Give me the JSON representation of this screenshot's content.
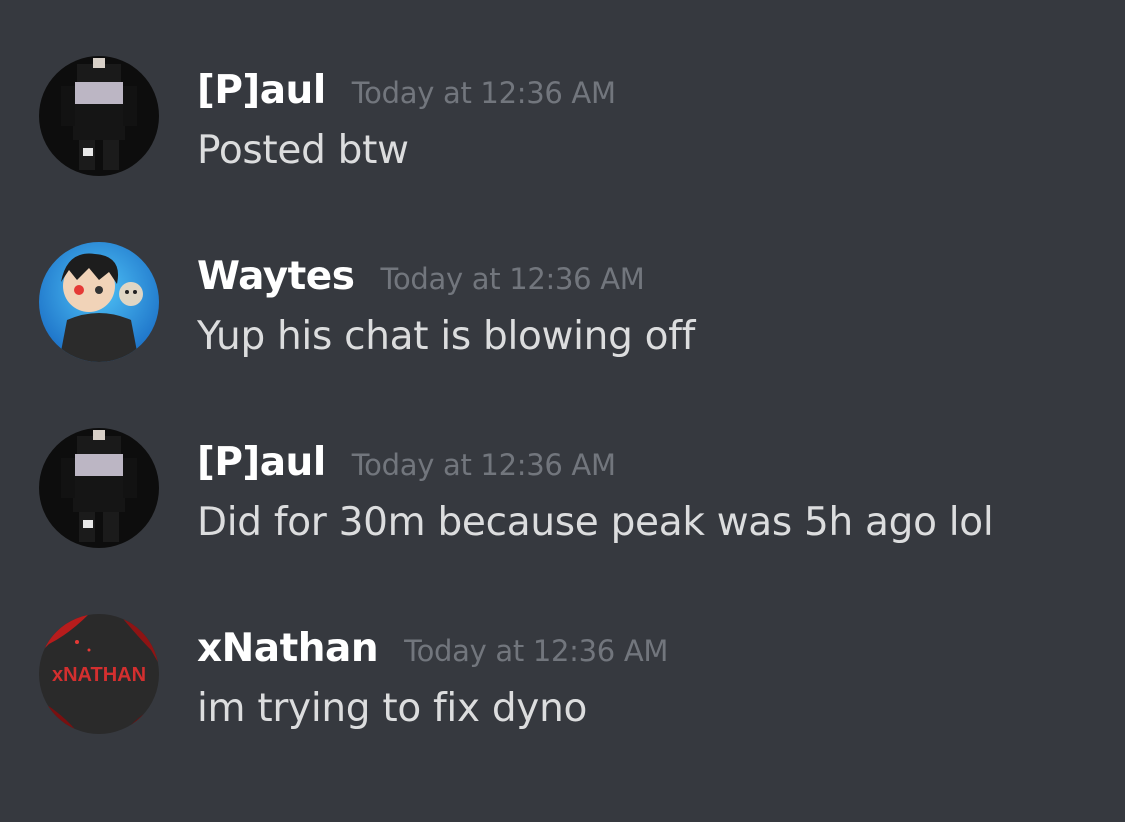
{
  "messages": [
    {
      "username": "[P]aul",
      "timestamp": "Today at 12:36 AM",
      "text": "Posted btw",
      "avatar": "paul-avatar"
    },
    {
      "username": "Waytes",
      "timestamp": "Today at 12:36 AM",
      "text": "Yup his chat is blowing off",
      "avatar": "waytes-avatar"
    },
    {
      "username": "[P]aul",
      "timestamp": "Today at 12:36 AM",
      "text": "Did for 30m because peak was 5h ago lol",
      "avatar": "paul-avatar"
    },
    {
      "username": "xNathan",
      "timestamp": "Today at 12:36 AM",
      "text": "im trying to fix dyno",
      "avatar": "xnathan-avatar",
      "avatar_text": "xNATHAN"
    }
  ],
  "colors": {
    "background": "#36393f",
    "username": "#ffffff",
    "timestamp": "#72767d",
    "message_text": "#dcddde"
  }
}
